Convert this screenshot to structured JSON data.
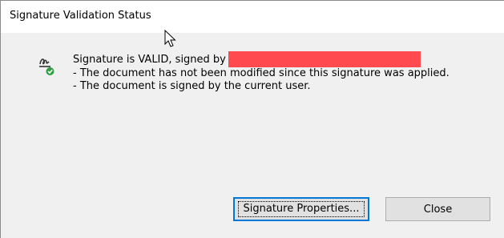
{
  "window": {
    "title": "Signature Validation Status"
  },
  "message": {
    "line1_prefix": "Signature is VALID, signed by",
    "line2": "- The document has not been modified since this signature was applied.",
    "line3": "- The document is signed by the current user."
  },
  "buttons": {
    "properties_label": "Signature Properties...",
    "close_label": "Close"
  },
  "icons": {
    "signature_status": "signature-valid-icon",
    "cursor": "mouse-pointer-icon"
  },
  "colors": {
    "redaction": "#ff4a4f",
    "valid_check": "#2ea043",
    "focus_border": "#0078d7"
  }
}
